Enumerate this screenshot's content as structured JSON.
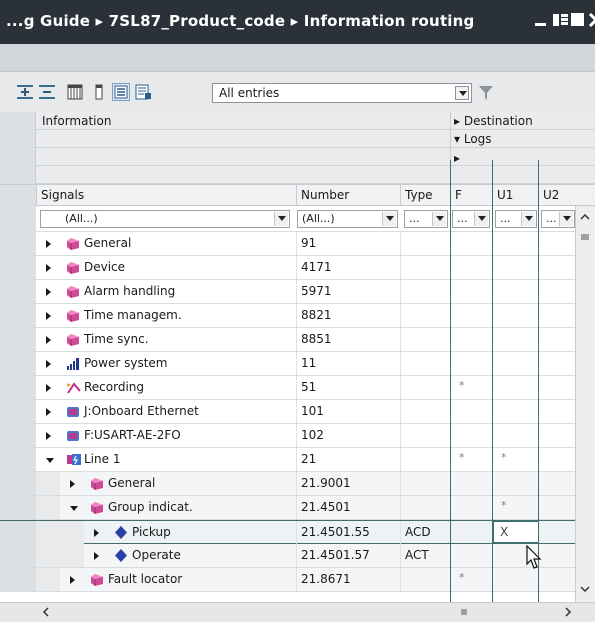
{
  "window": {
    "title": "...g Guide ▸ 7SL87_Product_code ▸ Information routing",
    "controls": [
      "minimize-icon",
      "tile-icon",
      "maximize-icon",
      "close-icon"
    ]
  },
  "toolbar": {
    "filter_value": "All entries",
    "icons": [
      "expand-all-icon",
      "collapse-all-icon",
      "column-view-icon",
      "single-column-icon",
      "list-view-icon",
      "export-icon",
      "filter-icon"
    ]
  },
  "group_headers": {
    "information": "Information",
    "destination": "▸ Destination",
    "logs": "▾ Logs",
    "more": "▸"
  },
  "columns": {
    "signals": "Signals",
    "number": "Number",
    "type": "Type",
    "f": "F",
    "u1": "U1",
    "u2": "U2"
  },
  "filters": {
    "signals": "(All...)",
    "number": "(All...)",
    "type": "...",
    "f": "...",
    "u1": "...",
    "u2": "..."
  },
  "rows": [
    {
      "label": "General",
      "number": "91",
      "type": "",
      "f": "",
      "u1": "",
      "icon": "folder-icon"
    },
    {
      "label": "Device",
      "number": "4171",
      "type": "",
      "f": "",
      "u1": "",
      "icon": "folder-icon"
    },
    {
      "label": "Alarm handling",
      "number": "5971",
      "type": "",
      "f": "",
      "u1": "",
      "icon": "folder-icon"
    },
    {
      "label": "Time managem.",
      "number": "8821",
      "type": "",
      "f": "",
      "u1": "",
      "icon": "folder-icon"
    },
    {
      "label": "Time sync.",
      "number": "8851",
      "type": "",
      "f": "",
      "u1": "",
      "icon": "folder-icon"
    },
    {
      "label": "Power system",
      "number": "11",
      "type": "",
      "f": "",
      "u1": "",
      "icon": "power-system-icon"
    },
    {
      "label": "Recording",
      "number": "51",
      "type": "",
      "f": "*",
      "u1": "",
      "icon": "recording-icon"
    },
    {
      "label": "J:Onboard Ethernet",
      "number": "101",
      "type": "",
      "f": "",
      "u1": "",
      "icon": "module-icon"
    },
    {
      "label": "F:USART-AE-2FO",
      "number": "102",
      "type": "",
      "f": "",
      "u1": "",
      "icon": "module-icon"
    },
    {
      "label": "Line 1",
      "number": "21",
      "type": "",
      "f": "*",
      "u1": "*",
      "icon": "line-function-icon"
    },
    {
      "label": "General",
      "number": "21.9001",
      "type": "",
      "f": "",
      "u1": "",
      "icon": "folder-icon"
    },
    {
      "label": "Group indicat.",
      "number": "21.4501",
      "type": "",
      "f": "",
      "u1": "*",
      "icon": "folder-icon"
    },
    {
      "label": "Pickup",
      "number": "21.4501.55",
      "type": "ACD",
      "f": "",
      "u1": "X",
      "icon": "signal-diamond-icon"
    },
    {
      "label": "Operate",
      "number": "21.4501.57",
      "type": "ACT",
      "f": "",
      "u1": "",
      "icon": "signal-diamond-icon"
    },
    {
      "label": "Fault locator",
      "number": "21.8671",
      "type": "",
      "f": "*",
      "u1": "",
      "icon": "folder-icon"
    }
  ],
  "colors": {
    "titlebar": "#2b3138",
    "folder": "#c0388a",
    "diamond": "#2a3fa8",
    "teal_line": "#3f6f6c"
  }
}
